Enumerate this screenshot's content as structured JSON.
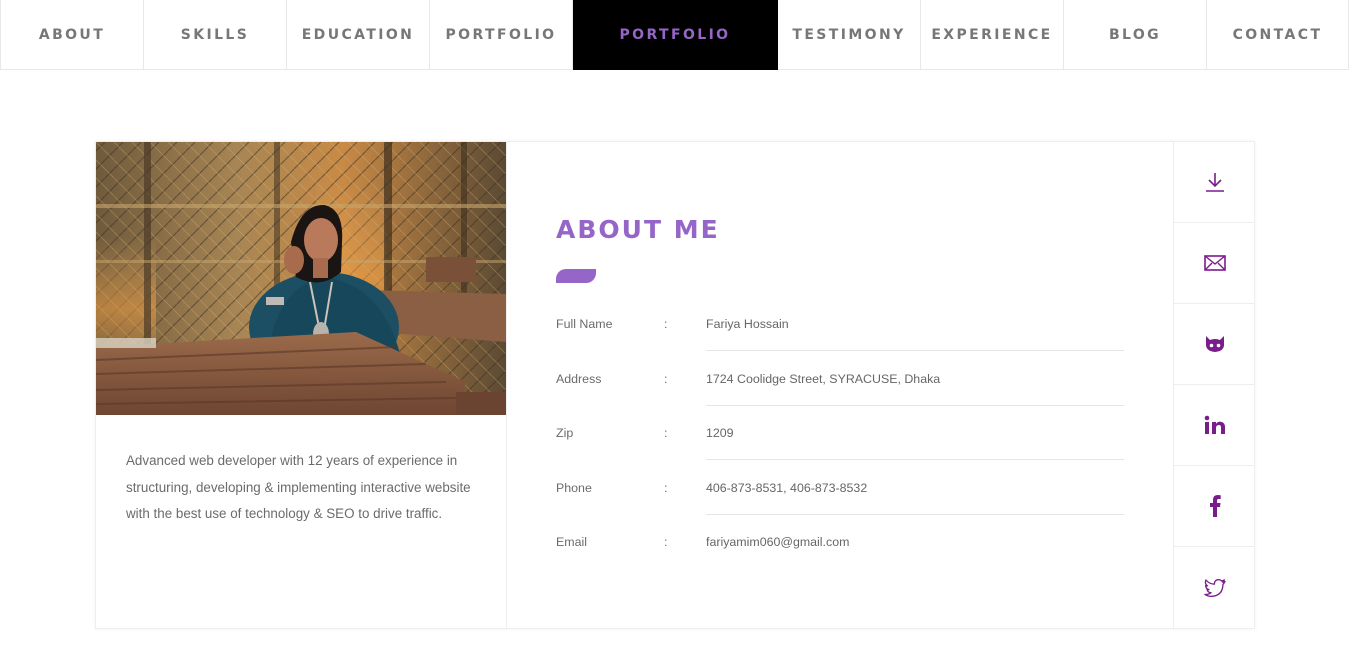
{
  "nav": {
    "items": [
      {
        "label": "ABOUT"
      },
      {
        "label": "SKILLS"
      },
      {
        "label": "EDUCATION"
      },
      {
        "label": "PORTFOLIO"
      },
      {
        "label": "PORTFOLIO",
        "active": true
      },
      {
        "label": "TESTIMONY"
      },
      {
        "label": "EXPERIENCE"
      },
      {
        "label": "BLOG"
      },
      {
        "label": "CONTACT"
      }
    ]
  },
  "profile": {
    "bio": "Advanced web developer with 12 years of experience in structuring, developing & implementing interactive website with the best use of technology & SEO to drive traffic."
  },
  "about": {
    "title": "ABOUT ME",
    "rows": [
      {
        "label": "Full Name",
        "separator": ":",
        "value": "Fariya Hossain"
      },
      {
        "label": "Address",
        "separator": ":",
        "value": "1724 Coolidge Street, SYRACUSE, Dhaka"
      },
      {
        "label": "Zip",
        "separator": ":",
        "value": "1209"
      },
      {
        "label": "Phone",
        "separator": ":",
        "value": "406-873-8531, 406-873-8532"
      },
      {
        "label": "Email",
        "separator": ":",
        "value": "fariyamim060@gmail.com"
      }
    ]
  },
  "social": {
    "icons": [
      "download-icon",
      "mail-icon",
      "github-icon",
      "linkedin-icon",
      "facebook-icon",
      "twitter-icon"
    ]
  },
  "colors": {
    "accent": "#9565c7",
    "icon": "#7b1c8c",
    "nav_active_bg": "#000000"
  }
}
